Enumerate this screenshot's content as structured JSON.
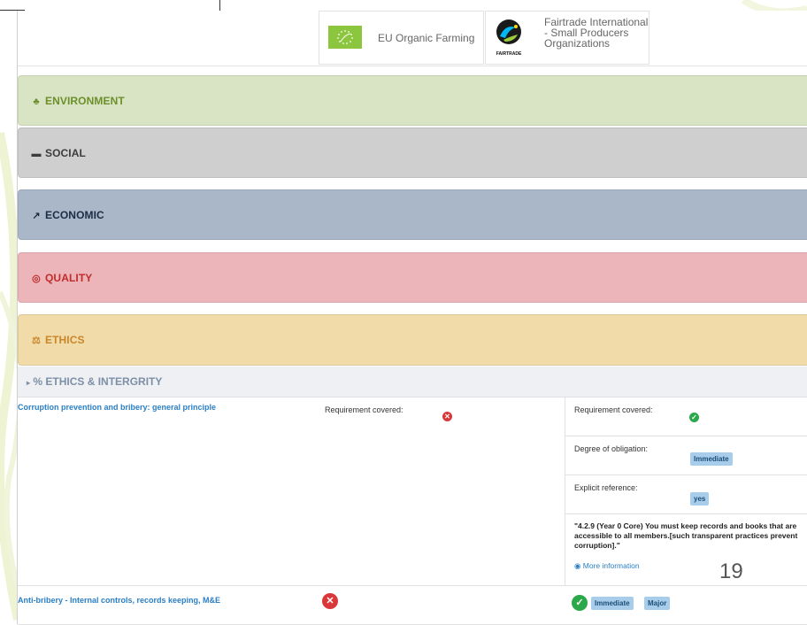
{
  "standards": [
    {
      "name": "EU Organic Farming",
      "logo": "eu-organic-leaf-logo"
    },
    {
      "name": "Fairtrade International - Small Producers Organizations",
      "logo": "fairtrade-logo",
      "logo_text": "FAIRTRADE"
    }
  ],
  "sections": {
    "environment": {
      "label": "ENVIRONMENT",
      "icon": "tree-icon",
      "color": "#d8e4c4"
    },
    "social": {
      "label": "SOCIAL",
      "icon": "comment-icon",
      "color": "#cfcfcf"
    },
    "economic": {
      "label": "ECONOMIC",
      "icon": "chart-icon",
      "color": "#a9b7c9"
    },
    "quality": {
      "label": "QUALITY",
      "icon": "target-icon",
      "color": "#ebb5b9"
    },
    "ethics": {
      "label": "ETHICS",
      "icon": "balance-icon",
      "color": "#f1dba8"
    }
  },
  "subsection": {
    "label": "ETHICS & INTERGRITY",
    "icon": "link-icon"
  },
  "rows": [
    {
      "criterion": "Corruption prevention and bribery: general principle",
      "std1": {
        "covered_label": "Requirement covered:",
        "covered": false
      },
      "std2": {
        "covered_label": "Requirement covered:",
        "covered": true,
        "obligation_label": "Degree of obligation:",
        "obligation": "Immediate",
        "reference_label": "Explicit reference:",
        "reference": "yes",
        "quote": "\"4.2.9 (Year 0 Core) You must keep records and books that are accessible to all members.[such transparent practices prevent corruption].\"",
        "more_link": "More information"
      }
    },
    {
      "criterion": "Anti-bribery - Internal controls, records keeping, M&E",
      "std1": {
        "covered": false
      },
      "std2": {
        "covered": true,
        "badges": [
          "Immediate",
          "Major"
        ]
      }
    }
  ],
  "page_number": "19"
}
